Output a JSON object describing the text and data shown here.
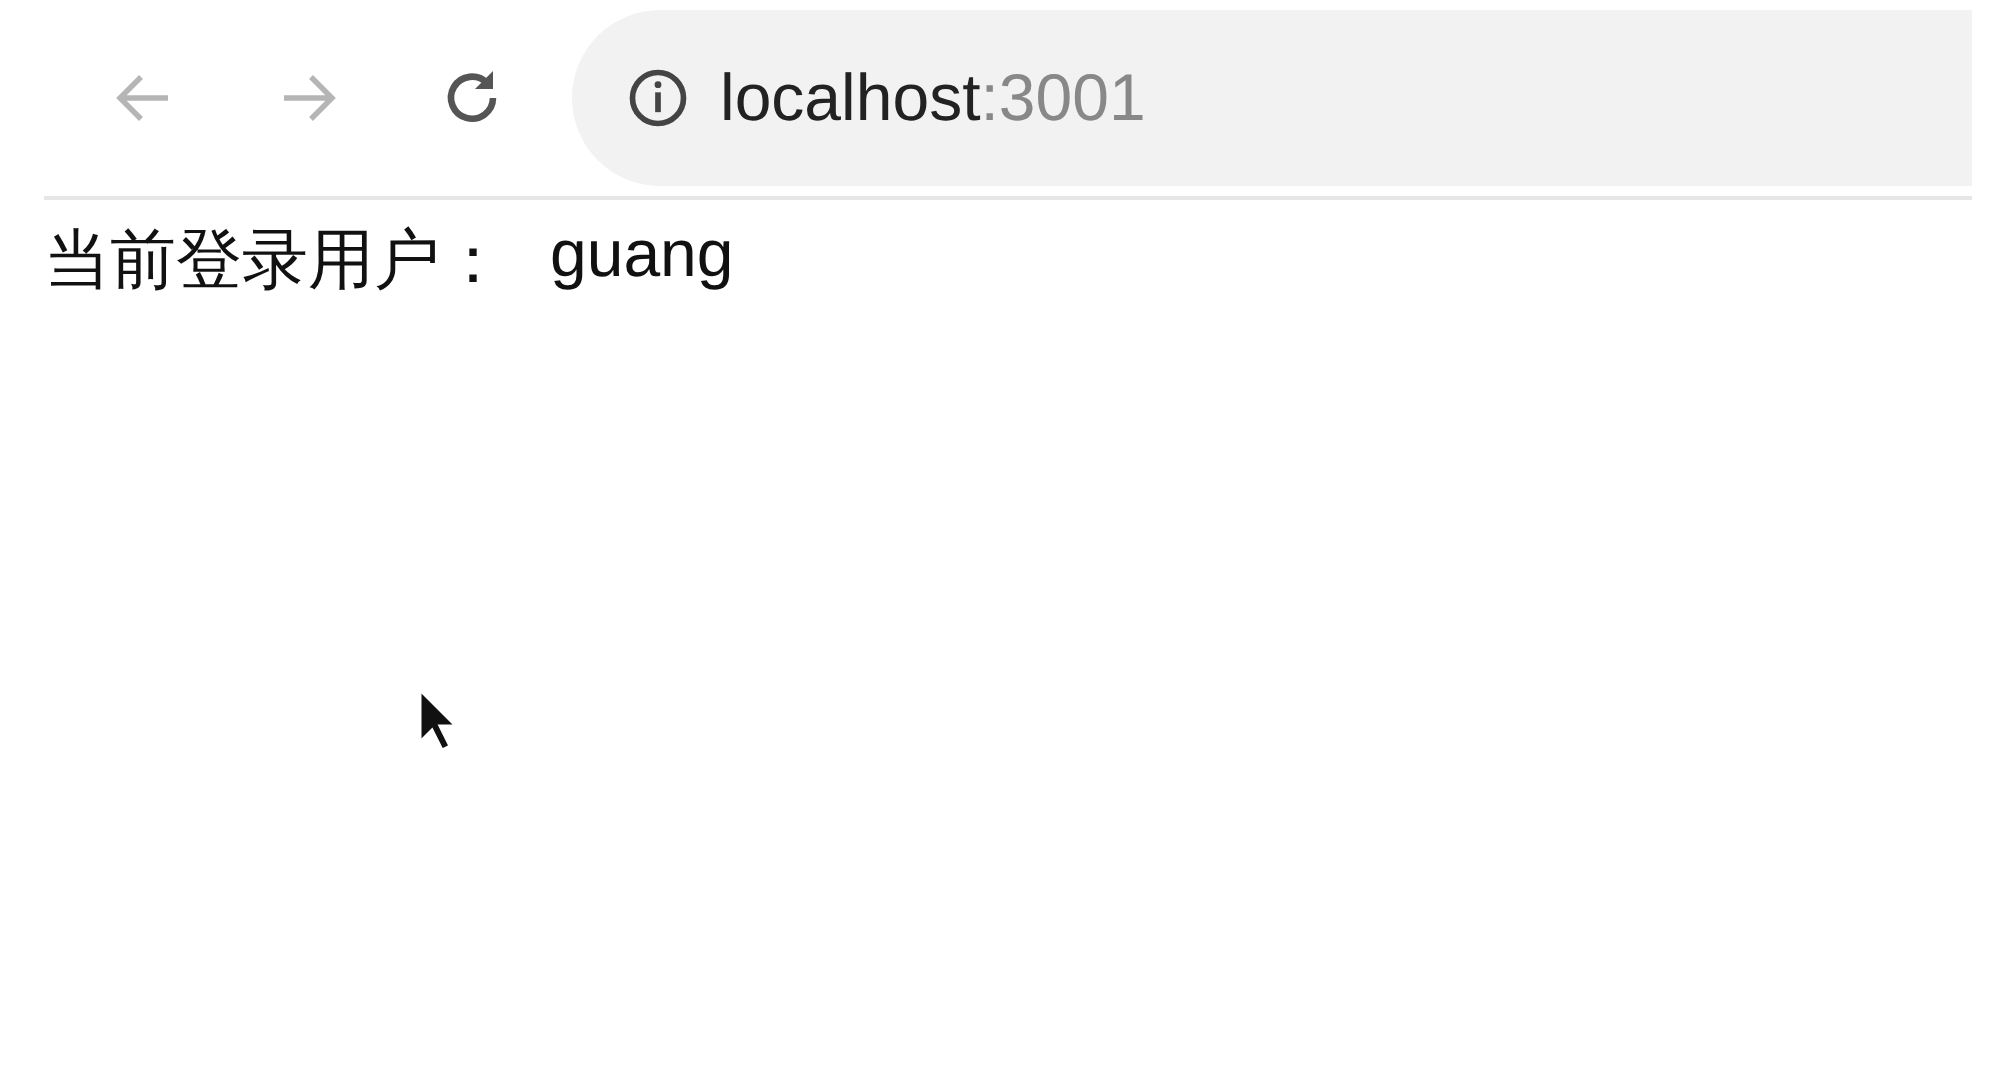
{
  "address_bar": {
    "host": "localhost",
    "port": ":3001"
  },
  "page": {
    "label": "当前登录用户：",
    "username": "guang"
  }
}
